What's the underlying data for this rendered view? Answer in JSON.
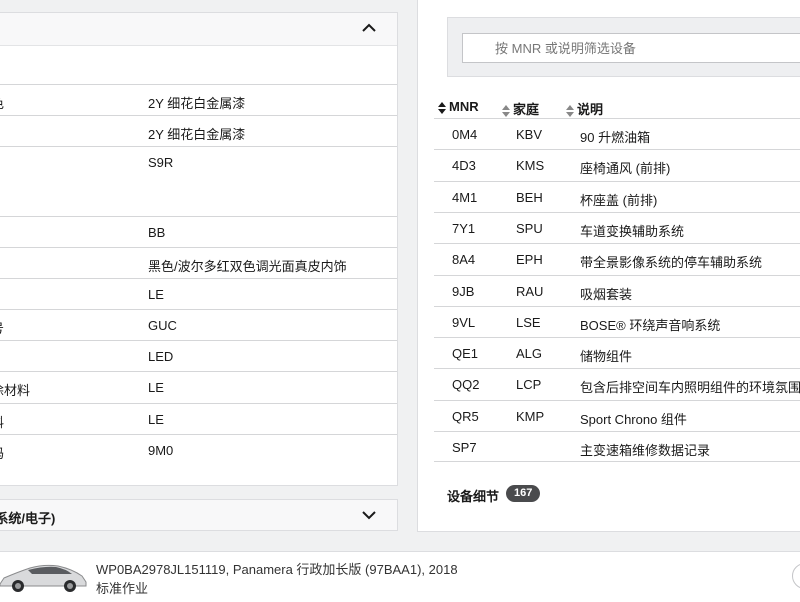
{
  "left_panel": {
    "section_title": "",
    "rows": [
      {
        "key": "色",
        "value": "2Y 细花白金属漆"
      },
      {
        "key": "",
        "value": "2Y 细花白金属漆"
      },
      {
        "key": "",
        "value": "S9R"
      },
      {
        "key": "",
        "value": "BB"
      },
      {
        "key": "",
        "value": "黑色/波尔多红双色调光面真皮内饰"
      },
      {
        "key": "",
        "value": "LE"
      },
      {
        "key": "号",
        "value": "GUC"
      },
      {
        "key": "",
        "value": "LED"
      },
      {
        "key": "涂材料",
        "value": "LE"
      },
      {
        "key": "料",
        "value": "LE"
      },
      {
        "key": "码",
        "value": "9M0"
      }
    ],
    "collapsed_section_title": "(系统/电子)"
  },
  "right_panel": {
    "filter_placeholder": "按 MNR 或说明筛选设备",
    "columns": [
      "MNR",
      "家庭",
      "说明"
    ],
    "rows": [
      {
        "mnr": "0M4",
        "family": "KBV",
        "desc": "90 升燃油箱"
      },
      {
        "mnr": "4D3",
        "family": "KMS",
        "desc": "座椅通风 (前排)"
      },
      {
        "mnr": "4M1",
        "family": "BEH",
        "desc": "杯座盖 (前排)"
      },
      {
        "mnr": "7Y1",
        "family": "SPU",
        "desc": "车道变换辅助系统"
      },
      {
        "mnr": "8A4",
        "family": "EPH",
        "desc": "带全景影像系统的停车辅助系统"
      },
      {
        "mnr": "9JB",
        "family": "RAU",
        "desc": "吸烟套装"
      },
      {
        "mnr": "9VL",
        "family": "LSE",
        "desc": "BOSE® 环绕声音响系统"
      },
      {
        "mnr": "QE1",
        "family": "ALG",
        "desc": "储物组件"
      },
      {
        "mnr": "QQ2",
        "family": "LCP",
        "desc": "包含后排空间车内照明组件的环境氛围"
      },
      {
        "mnr": "QR5",
        "family": "KMP",
        "desc": "Sport Chrono 组件"
      },
      {
        "mnr": "SP7",
        "family": "",
        "desc": "主变速箱维修数据记录"
      }
    ],
    "detail_label": "设备细节",
    "detail_count": "167"
  },
  "bottom_bar": {
    "vehicle": "WP0BA2978JL151119, Panamera 行政加长版 (97BAA1), 2018",
    "job": "标准作业"
  }
}
